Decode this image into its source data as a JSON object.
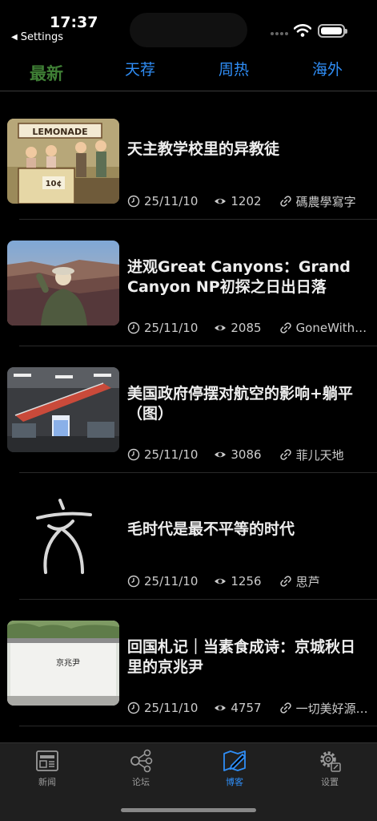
{
  "status": {
    "time": "17:37",
    "back_label": "Settings"
  },
  "tabs": [
    {
      "label": "最新",
      "active": true
    },
    {
      "label": "天荐",
      "active": false
    },
    {
      "label": "周热",
      "active": false
    },
    {
      "label": "海外",
      "active": false
    }
  ],
  "articles": [
    {
      "title": "天主教学校里的异教徒",
      "date": "25/11/10",
      "views": "1202",
      "author": "碼農學寫字",
      "thumb": "lemonade-stand-painting",
      "sign_text": "LEMONADE",
      "price_text": "10¢"
    },
    {
      "title": "进观Great Canyons：Grand Canyon NP初探之日出日落",
      "date": "25/11/10",
      "views": "2085",
      "author": "GoneWithWi…",
      "thumb": "grand-canyon-photo"
    },
    {
      "title": "美国政府停摆对航空的影响+躺平（图）",
      "date": "25/11/10",
      "views": "3086",
      "author": "菲儿天地",
      "thumb": "airport-terminal-photo"
    },
    {
      "title": "毛时代是最不平等的时代",
      "date": "25/11/10",
      "views": "1256",
      "author": "思芦",
      "thumb": "calligraphy-logo"
    },
    {
      "title": "回国札记｜当素食成诗：京城秋日里的京兆尹",
      "date": "25/11/10",
      "views": "4757",
      "author": "一切美好源于…",
      "thumb": "restaurant-wall-photo",
      "sign_text": "京兆尹"
    }
  ],
  "bottom_nav": [
    {
      "label": "新闻",
      "icon": "newspaper-icon",
      "active": false
    },
    {
      "label": "论坛",
      "icon": "forum-icon",
      "active": false
    },
    {
      "label": "博客",
      "icon": "blog-icon",
      "active": true
    },
    {
      "label": "设置",
      "icon": "settings-icon",
      "active": false
    }
  ],
  "colors": {
    "accent": "#2f8df5",
    "active_tab": "#3f7f35",
    "background": "#000000",
    "tab_bar": "#1f1f1f"
  }
}
